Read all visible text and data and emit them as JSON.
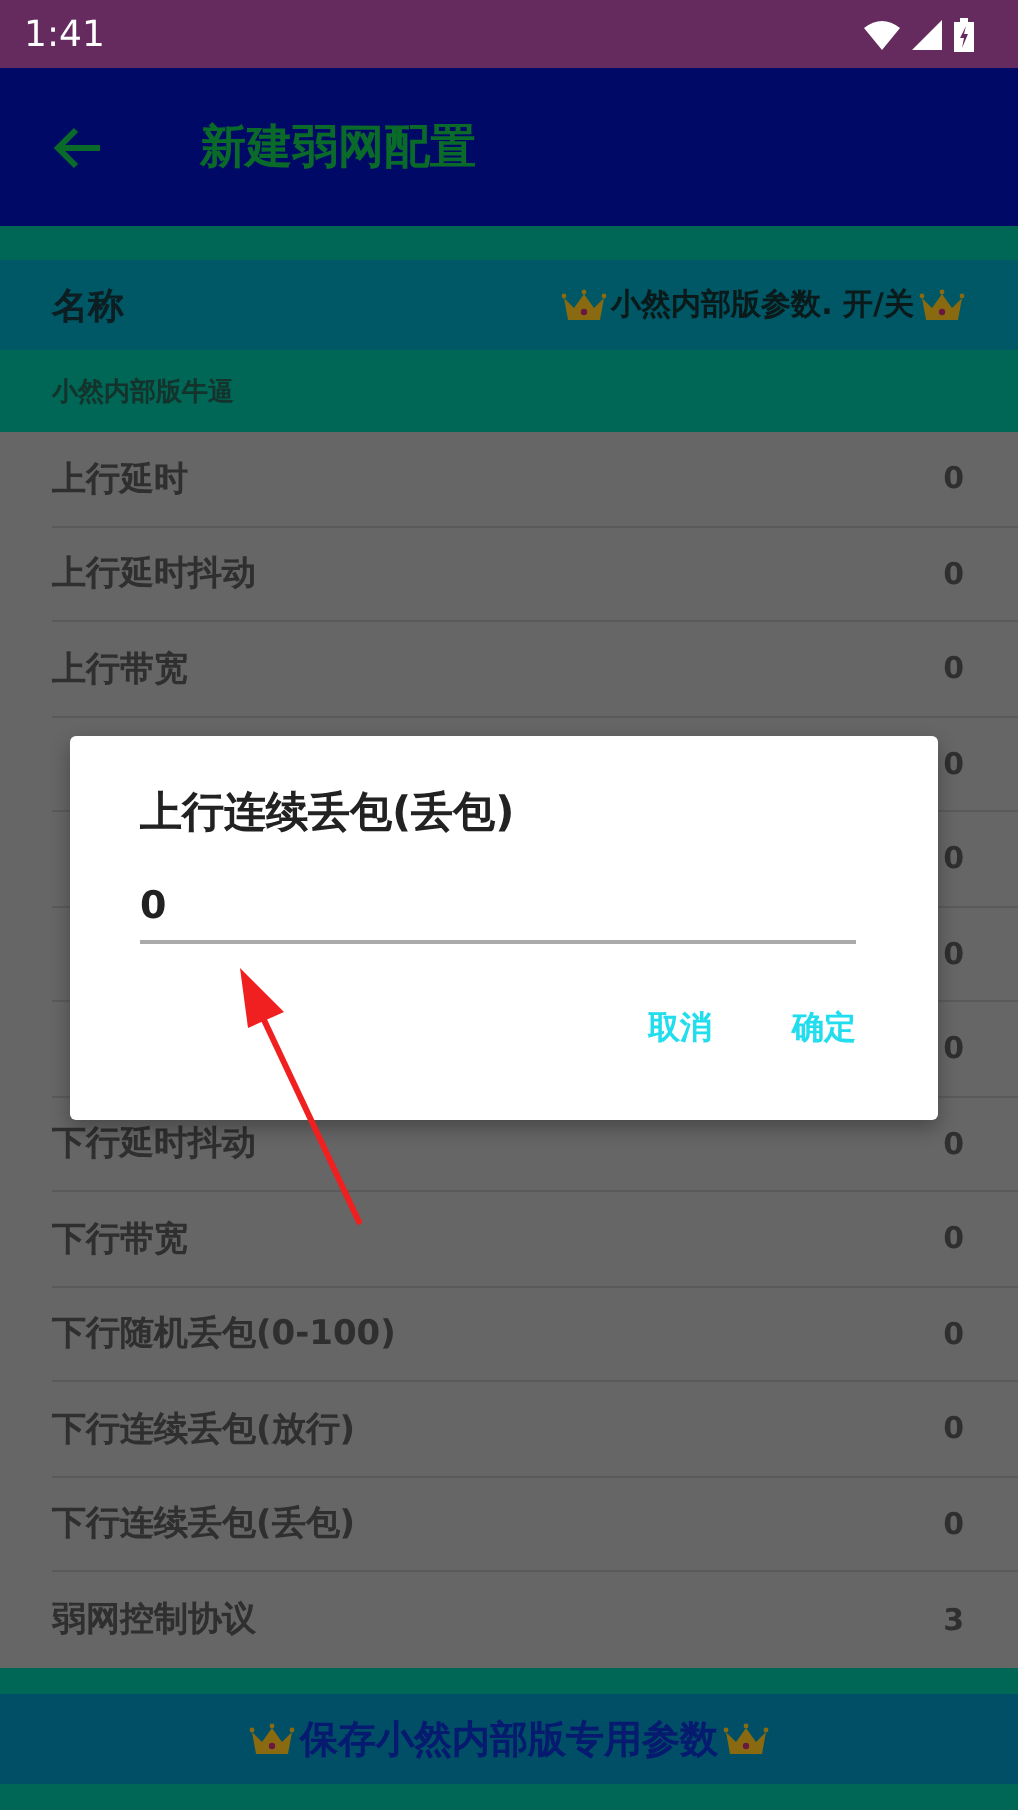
{
  "status_bar": {
    "time": "1:41"
  },
  "app_bar": {
    "title": "新建弱网配置"
  },
  "header": {
    "label": "名称",
    "toggle_text": "小然内部版参数. 开/关"
  },
  "section": {
    "title": "小然内部版牛逼"
  },
  "rows": [
    {
      "label": "上行延时",
      "value": "0"
    },
    {
      "label": "上行延时抖动",
      "value": "0"
    },
    {
      "label": "上行带宽",
      "value": "0"
    },
    {
      "value": "0"
    },
    {
      "value": "0"
    },
    {
      "value": "0"
    },
    {
      "value": "0"
    },
    {
      "label": "下行延时抖动",
      "value": "0"
    },
    {
      "label": "下行带宽",
      "value": "0"
    },
    {
      "label": "下行随机丢包(0-100)",
      "value": "0"
    },
    {
      "label": "下行连续丢包(放行)",
      "value": "0"
    },
    {
      "label": "下行连续丢包(丢包)",
      "value": "0"
    },
    {
      "label": "弱网控制协议",
      "value": "3"
    }
  ],
  "dialog": {
    "title": "上行连续丢包(丢包)",
    "value": "0",
    "buttons": [
      "取消",
      "确定"
    ]
  },
  "save_button": {
    "label": "保存小然内部版专用参数"
  }
}
